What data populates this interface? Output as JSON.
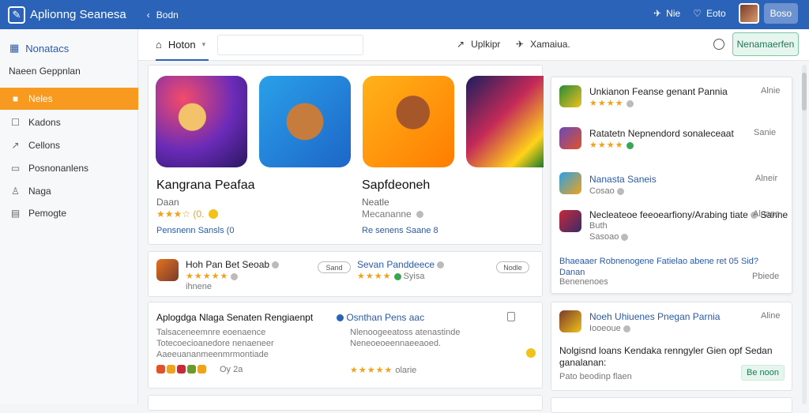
{
  "header": {
    "app_title": "Aplionng Seanesa",
    "back_label": "Bodn",
    "item1_label": "Nie",
    "item2_label": "Eoto",
    "user_label": "Boso"
  },
  "sidebar": {
    "heading": "Nonatacs",
    "sub": "Naeen Geppnlan",
    "items": [
      {
        "label": "Neles",
        "icon": "tag-icon"
      },
      {
        "label": "Kadons",
        "icon": "list-icon"
      },
      {
        "label": "Cellons",
        "icon": "chart-icon"
      },
      {
        "label": "Posnonanlens",
        "icon": "doc-icon"
      },
      {
        "label": "Naga",
        "icon": "user-icon"
      },
      {
        "label": "Pemogte",
        "icon": "grid-icon"
      }
    ]
  },
  "tabs": {
    "home": "Hoton",
    "tab_a": "Uplkipr",
    "tab_b": "Xamaiua.",
    "new_button": "Nenamaerfen"
  },
  "featured": [
    {
      "title": "Kangrana Peafaa",
      "sub": "Daan",
      "rating": "★★★☆ (0.",
      "link": "Pensnenn Sansls (0"
    },
    {
      "title": "Sapfdeoneh",
      "sub": "Neatle",
      "rating": "Mecananne",
      "link": "Re senens Saane 8"
    }
  ],
  "list_row1": {
    "left_title": "Hoh Pan Bet Seoab",
    "left_rating": "ihnene",
    "left_badge": "Sand",
    "right_title": "Sevan Panddeece",
    "right_rating": "Syisa",
    "right_badge": "Nodle"
  },
  "list_row2": {
    "left_title": "Aplogdga Nlaga Senaten Rengiaenpt",
    "left_lines": [
      "Talsaceneemnre eoenaence",
      "Totecoecioanedore nenaeneer",
      "Aaeeuananmeenmrmontiade"
    ],
    "left_meta": "Oy 2a",
    "right_title": "Osnthan Pens aac",
    "right_lines": [
      "Nlenoogeeatoss atenastinde",
      "Neneoeoeennaeeaoed."
    ],
    "right_meta": "olarie"
  },
  "right_panel": [
    {
      "title": "Unkianon Feanse genant Pannia",
      "meta": "Alnie",
      "sub": "★★★★"
    },
    {
      "title": "Ratatetn Nepnendord sonaleceaat",
      "meta": "Sanie",
      "sub": "★★★★"
    },
    {
      "title": "Nanasta Saneis",
      "meta": "Alneir",
      "sub": "Cosao"
    },
    {
      "title": "Necleateoe feeoearfiony/Arabing tiate",
      "title_tail": "Sanne",
      "line2": "Buth",
      "meta": "Alnane",
      "sub": "Sasoao"
    }
  ],
  "right_panel_footer": {
    "line1": "Bhaeaaer Robnenogene Fatielao abene ret 05 Sid?",
    "line2": "Danan",
    "date": "Benenenoes",
    "right": "Pbiede"
  },
  "right_panel2": {
    "title": "Noeh Uhiuenes Pnegan Parnia",
    "sub": "Iooeoue",
    "meta": "Aline",
    "text1": "Nolgisnd loans Kendaka renngyler Gien opf Sedan",
    "text2": "ganalanan:",
    "foot": "Pato beodinp flaen",
    "button": "Be noon"
  }
}
